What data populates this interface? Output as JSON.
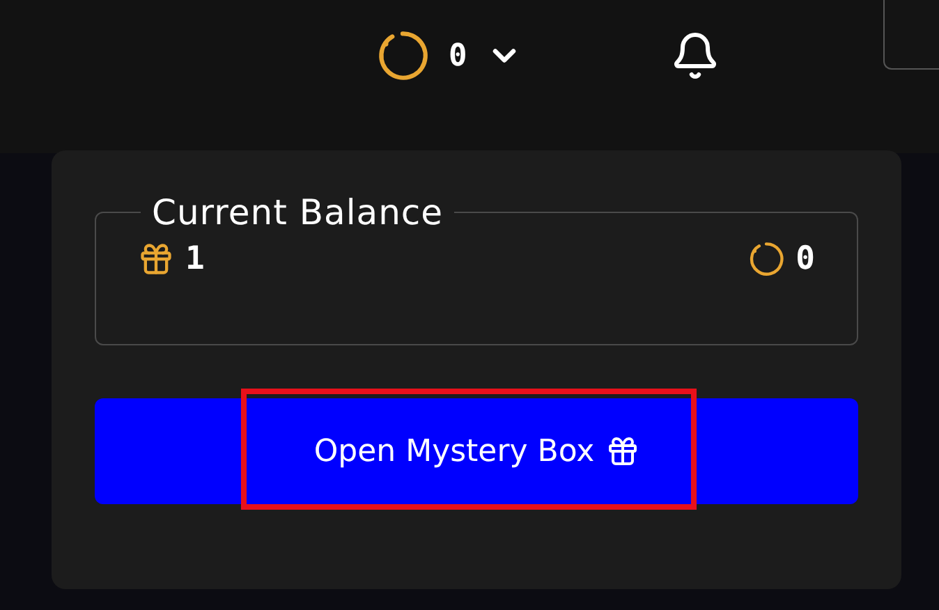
{
  "header": {
    "balance": "0"
  },
  "balance_card": {
    "legend": "Current Balance",
    "boxes": "1",
    "balance": "0"
  },
  "action_button": {
    "label": "Open Mystery Box",
    "highlighted": true
  }
}
